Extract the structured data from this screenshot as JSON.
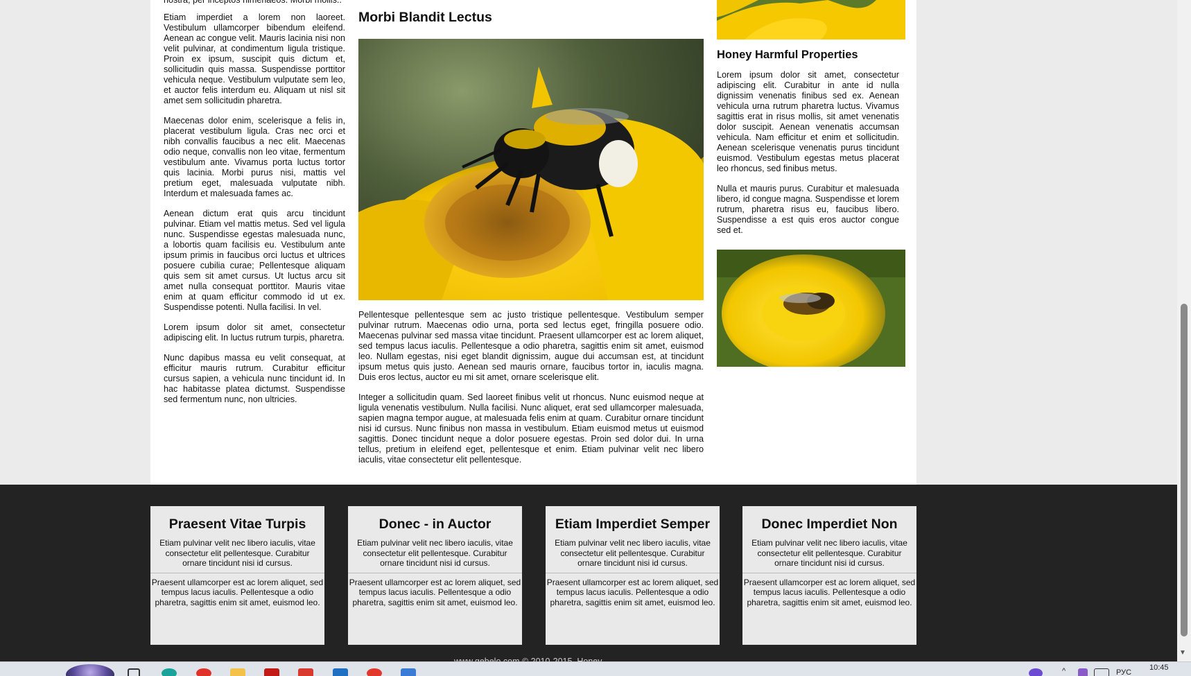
{
  "left_column": {
    "paragraphs": [
      "nostra, per inceptos himenaeos. Morbi mollis..",
      "Etiam imperdiet a lorem non laoreet. Vestibulum ullamcorper bibendum eleifend. Aenean ac congue velit. Mauris lacinia nisi non velit pulvinar, at condimentum ligula tristique. Proin ex ipsum, suscipit quis dictum et, sollicitudin quis massa. Suspendisse porttitor vehicula neque. Vestibulum vulputate sem leo, et auctor felis interdum eu. Aliquam ut nisl sit amet sem sollicitudin pharetra.",
      "Maecenas dolor enim, scelerisque a felis in, placerat vestibulum ligula. Cras nec orci et nibh convallis faucibus a nec elit. Maecenas odio neque, convallis non leo vitae, fermentum vestibulum ante. Vivamus porta luctus tortor quis lacinia. Morbi purus nisi, mattis vel pretium eget, malesuada vulputate nibh. Interdum et malesuada fames ac.",
      "Aenean dictum erat quis arcu tincidunt pulvinar. Etiam vel mattis metus. Sed vel ligula nunc. Suspendisse egestas malesuada nunc, a lobortis quam facilisis eu. Vestibulum ante ipsum primis in faucibus orci luctus et ultrices posuere cubilia curae; Pellentesque aliquam quis sem sit amet cursus. Ut luctus arcu sit amet nulla consequat porttitor. Mauris vitae enim at quam efficitur commodo id ut ex. Suspendisse potenti. Nulla facilisi. In vel.",
      "Lorem ipsum dolor sit amet, consectetur adipiscing elit. In luctus rutrum turpis, pharetra.",
      "Nunc dapibus massa eu velit consequat, at efficitur mauris rutrum. Curabitur efficitur cursus sapien, a vehicula nunc tincidunt id. In hac habitasse platea dictumst. Suspendisse sed fermentum nunc, non ultricies."
    ]
  },
  "middle_column": {
    "title": "Morbi Blandit Lectus",
    "paragraphs": [
      "Pellentesque pellentesque sem ac justo tristique pellentesque. Vestibulum semper pulvinar rutrum. Maecenas odio urna, porta sed lectus eget, fringilla posuere odio. Maecenas pulvinar sed massa vitae tincidunt. Praesent ullamcorper est ac lorem aliquet, sed tempus lacus iaculis. Pellentesque a odio pharetra, sagittis enim sit amet, euismod leo. Nullam egestas, nisi eget blandit dignissim, augue dui accumsan est, at tincidunt ipsum metus quis justo. Aenean sed mauris ornare, faucibus tortor in, iaculis magna. Duis eros lectus, auctor eu mi sit amet, ornare scelerisque elit.",
      "Integer a sollicitudin quam. Sed laoreet finibus velit ut rhoncus. Nunc euismod neque at ligula venenatis vestibulum. Nulla facilisi. Nunc aliquet, erat sed ullamcorper malesuada, sapien magna tempor augue, at malesuada felis enim at quam. Curabitur ornare tincidunt nisi id cursus. Nunc finibus non massa in vestibulum. Etiam euismod metus ut euismod sagittis. Donec tincidunt neque a dolor posuere egestas. Proin sed dolor dui. In urna tellus, pretium in eleifend eget, pellentesque et enim. Etiam pulvinar velit nec libero iaculis, vitae consectetur elit pellentesque."
    ]
  },
  "right_column": {
    "title": "Honey Harmful Properties",
    "paragraphs": [
      "Lorem ipsum dolor sit amet, consectetur adipiscing elit. Curabitur in ante id nulla dignissim venenatis finibus sed ex. Aenean vehicula urna rutrum pharetra luctus. Vivamus sagittis erat in risus mollis, sit amet venenatis dolor suscipit. Aenean venenatis accumsan vehicula. Nam efficitur et enim et sollicitudin. Aenean scelerisque venenatis purus tincidunt euismod. Vestibulum egestas metus placerat leo rhoncus, sed finibus metus.",
      "Nulla et mauris purus. Curabitur et malesuada libero, id congue magna. Suspendisse et lorem rutrum, pharetra risus eu, faucibus libero. Suspendisse a est quis eros auctor congue sed et."
    ]
  },
  "footer": {
    "cards": [
      {
        "title": "Praesent Vitae Turpis",
        "text1": "Etiam pulvinar velit nec libero iaculis, vitae consectetur elit pellentesque. Curabitur ornare tincidunt nisi id cursus.",
        "text2": "Praesent ullamcorper est ac lorem aliquet, sed tempus lacus iaculis. Pellentesque a odio pharetra, sagittis enim sit amet, euismod leo."
      },
      {
        "title": "Donec - in Auctor",
        "text1": "Etiam pulvinar velit nec libero iaculis, vitae consectetur elit pellentesque. Curabitur ornare tincidunt nisi id cursus.",
        "text2": "Praesent ullamcorper est ac lorem aliquet, sed tempus lacus iaculis. Pellentesque a odio pharetra, sagittis enim sit amet, euismod leo."
      },
      {
        "title": "Etiam Imperdiet Semper",
        "text1": "Etiam pulvinar velit nec libero iaculis, vitae consectetur elit pellentesque. Curabitur ornare tincidunt nisi id cursus.",
        "text2": "Praesent ullamcorper est ac lorem aliquet, sed tempus lacus iaculis. Pellentesque a odio pharetra, sagittis enim sit amet, euismod leo."
      },
      {
        "title": "Donec Imperdiet Non",
        "text1": "Etiam pulvinar velit nec libero iaculis, vitae consectetur elit pellentesque. Curabitur ornare tincidunt nisi id cursus.",
        "text2": "Praesent ullamcorper est ac lorem aliquet, sed tempus lacus iaculis. Pellentesque a odio pharetra, sagittis enim sit amet, euismod leo."
      }
    ],
    "copyright": "www.gebelo.com © 2010-2015. Honey"
  },
  "taskbar": {
    "language": "РУС",
    "clock": "10:45",
    "icons": [
      "start-orb",
      "task-view",
      "edge",
      "yandex",
      "file-explorer",
      "pdf-reader",
      "gmail",
      "mail",
      "chrome",
      "app-tiles"
    ],
    "tray_icons": [
      "onedrive",
      "show-hidden",
      "visual-studio",
      "keyboard"
    ]
  },
  "colors": {
    "page_bg": "#ebebeb",
    "content_bg": "#ffffff",
    "footer_bg": "#232323",
    "card_bg": "#e9e9e9"
  }
}
